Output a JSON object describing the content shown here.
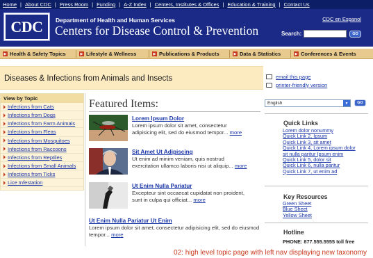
{
  "top_links": [
    "Home",
    "About CDC",
    "Press Room",
    "Funding",
    "A-Z Index",
    "Centers, Institutes & Offices",
    "Education & Training",
    "Contact Us"
  ],
  "header": {
    "logo": "CDC",
    "department": "Department of Health and Human Services",
    "agency": "Centers for Disease Control & Prevention",
    "espanol": "CDC en Espanol",
    "search_label": "Search:",
    "go_label": "GO"
  },
  "nav": [
    "Health & Safety Topics",
    "Lifestyle & Wellness",
    "Publications & Products",
    "Data & Statistics",
    "Conferences & Events"
  ],
  "page_title": "Diseases & Infections from Animals and Insects",
  "tools": {
    "email": "email this page",
    "print": "printer-friendly version"
  },
  "left_nav": {
    "heading": "View by Topic",
    "items": [
      "Infections from Cats",
      "Infections from Dogs",
      "Infections from Farm Animals",
      "Infections from Fleas",
      "Infections from Mosquitoes",
      "Infections from Raccoons",
      "Infections from Reptiles",
      "Infections from Small Animals",
      "Infections from Ticks",
      "Lice Infestation"
    ]
  },
  "featured": {
    "heading": "Featured Items:",
    "more_label": "more",
    "items": [
      {
        "title": "Lorem Ipsum Dolor",
        "line1": "Lorem ipsum dolor sit amet, consectetur",
        "line2": "adipisicing elit, sed do eiusmod tempor..."
      },
      {
        "title": "Sit Amet Ut Adipiscing",
        "line1": "Ut enim ad minim veniam, quis nostrud",
        "line2": "exercitation ullamco laboris nisi ut aliquip..."
      },
      {
        "title": "Ut Enim Nulla Pariatur",
        "line1": "Excepteur sint occaecat cupidatat non proident,",
        "line2": "sunt in culpa qui officiat..."
      },
      {
        "title": "Ut Enim Nulla Pariatur Ut Enim",
        "line1": "Lorem ipsum dolor sit amet, consectetur adipisicing elit, sed do eiusmod",
        "line2": "tempor..."
      }
    ]
  },
  "language": {
    "selected": "English",
    "go_label": "GO"
  },
  "quick_links": {
    "heading": "Quick Links",
    "items": [
      "Lorem dolor nonummy",
      "Quick Link 2, Ipsum",
      "Quick Link 3, sit amet",
      "Quick Link 4, Lorem ipsum dolor",
      "sit nulla paritur Ipsum enim",
      "Quick Link 5, dolor sit",
      "Quick Link 6, nulla paritur",
      "Quick Link 7, ut enim ad"
    ]
  },
  "key_resources": {
    "heading": "Key Resources",
    "items": [
      "Green Sheet",
      "Blue Sheet",
      "Yellow Sheet"
    ]
  },
  "hotline": {
    "heading": "Hotline",
    "phone": "PHONE: 877.555.5555 toll free"
  },
  "caption": "02: high level topic page with left nav displaying new taxonomy",
  "colors": {
    "top_bar": "#0b1e66",
    "header": "#1a2a86",
    "nav": "#e8ca8e",
    "title_band": "#fcebc1",
    "accent": "#c8381d",
    "link": "#1a35a8"
  }
}
